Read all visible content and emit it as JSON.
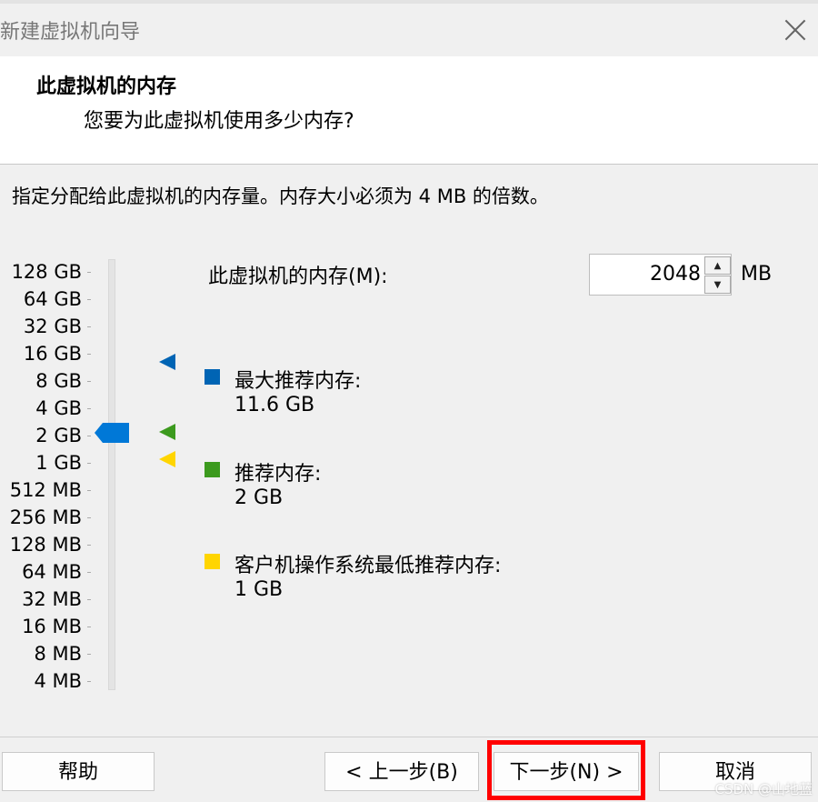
{
  "window": {
    "title": "新建虚拟机向导",
    "close_icon": "close-icon"
  },
  "header": {
    "title": "此虚拟机的内存",
    "subtitle": "您要为此虚拟机使用多少内存?"
  },
  "description": "指定分配给此虚拟机的内存量。内存大小必须为 4 MB 的倍数。",
  "slider": {
    "scale_labels": [
      "128 GB",
      "64 GB",
      "32 GB",
      "16 GB",
      "8 GB",
      "4 GB",
      "2 GB",
      "1 GB",
      "512 MB",
      "256 MB",
      "128 MB",
      "64 MB",
      "32 MB",
      "16 MB",
      "8 MB",
      "4 MB"
    ],
    "selected_label": "2 GB",
    "thumb_color": "#0078d7",
    "markers": {
      "max_recommended_color": "#0064b4",
      "recommended_color": "#3c9a1e",
      "guest_min_color": "#ffd500"
    }
  },
  "memory": {
    "label": "此虚拟机的内存(M):",
    "value": "2048",
    "unit": "MB"
  },
  "legend": {
    "max_recommended": {
      "label": "最大推荐内存:",
      "value": "11.6 GB",
      "color": "#0064b4"
    },
    "recommended": {
      "label": "推荐内存:",
      "value": "2 GB",
      "color": "#3c9a1e"
    },
    "guest_min": {
      "label": "客户机操作系统最低推荐内存:",
      "value": "1 GB",
      "color": "#ffd500"
    }
  },
  "buttons": {
    "help": "帮助",
    "back": "< 上一步(B)",
    "next": "下一步(N) >",
    "cancel": "取消"
  },
  "watermark": "CSDN @山地蓝",
  "highlight_color": "#ff0000"
}
